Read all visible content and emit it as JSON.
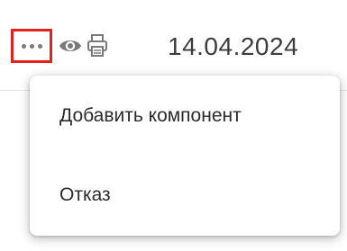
{
  "toolbar": {
    "more_icon": "ellipsis-horizontal-icon",
    "view_icon": "eye-icon",
    "print_icon": "printer-icon",
    "highlight_color": "#e3211f",
    "icon_color": "#7a7a7a"
  },
  "row": {
    "date": "14.04.2024"
  },
  "context_menu": {
    "items": [
      {
        "label": "Добавить компонент"
      },
      {
        "label": "Отказ"
      }
    ]
  }
}
